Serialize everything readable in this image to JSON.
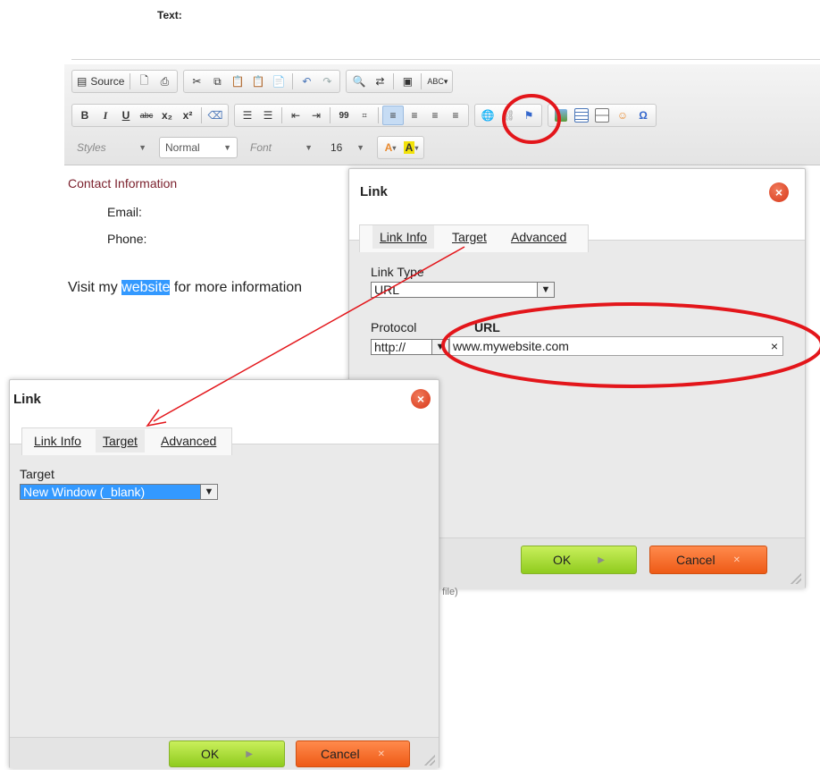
{
  "page": {
    "label": "Text:"
  },
  "toolbar": {
    "row1": {
      "source_label": "Source",
      "icons": [
        "source-icon",
        "preview-icon",
        "print-icon",
        "cut-icon",
        "copy-icon",
        "paste-icon",
        "paste-text-icon",
        "paste-word-icon",
        "undo-icon",
        "redo-icon",
        "find-icon",
        "replace-icon",
        "select-all-icon",
        "spellcheck-icon"
      ]
    },
    "row2": {
      "bold": "B",
      "italic": "I",
      "underline": "U",
      "strike": "abc",
      "subscript": "x₂",
      "superscript": "x²",
      "blockquote": "99"
    },
    "row3": {
      "styles_placeholder": "Styles",
      "format_value": "Normal",
      "font_placeholder": "Font",
      "size_value": "16"
    }
  },
  "document": {
    "heading": "Contact Information",
    "email_label": "Email:",
    "phone_label": "Phone:",
    "visit_prefix": "Visit my",
    "visit_link": "website",
    "visit_suffix": "for more information"
  },
  "link_dialog_main": {
    "title": "Link",
    "tabs": [
      "Link Info",
      "Target",
      "Advanced"
    ],
    "link_type_label": "Link Type",
    "link_type_value": "URL",
    "protocol_label": "Protocol",
    "protocol_value": "http://",
    "url_label": "URL",
    "url_value": "www.mywebsite.com",
    "clear_glyph": "×",
    "ok_label": "OK",
    "cancel_label": "Cancel",
    "behind_text": "file)"
  },
  "link_dialog_target": {
    "title": "Link",
    "tabs": [
      "Link Info",
      "Target",
      "Advanced"
    ],
    "target_label": "Target",
    "target_value": "New Window (_blank)",
    "ok_label": "OK",
    "cancel_label": "Cancel"
  },
  "colors": {
    "annotation_red": "#e3161b",
    "ok_green": "#8fcb1e",
    "cancel_orange": "#ee5a16",
    "selection_blue": "#3399ff"
  }
}
